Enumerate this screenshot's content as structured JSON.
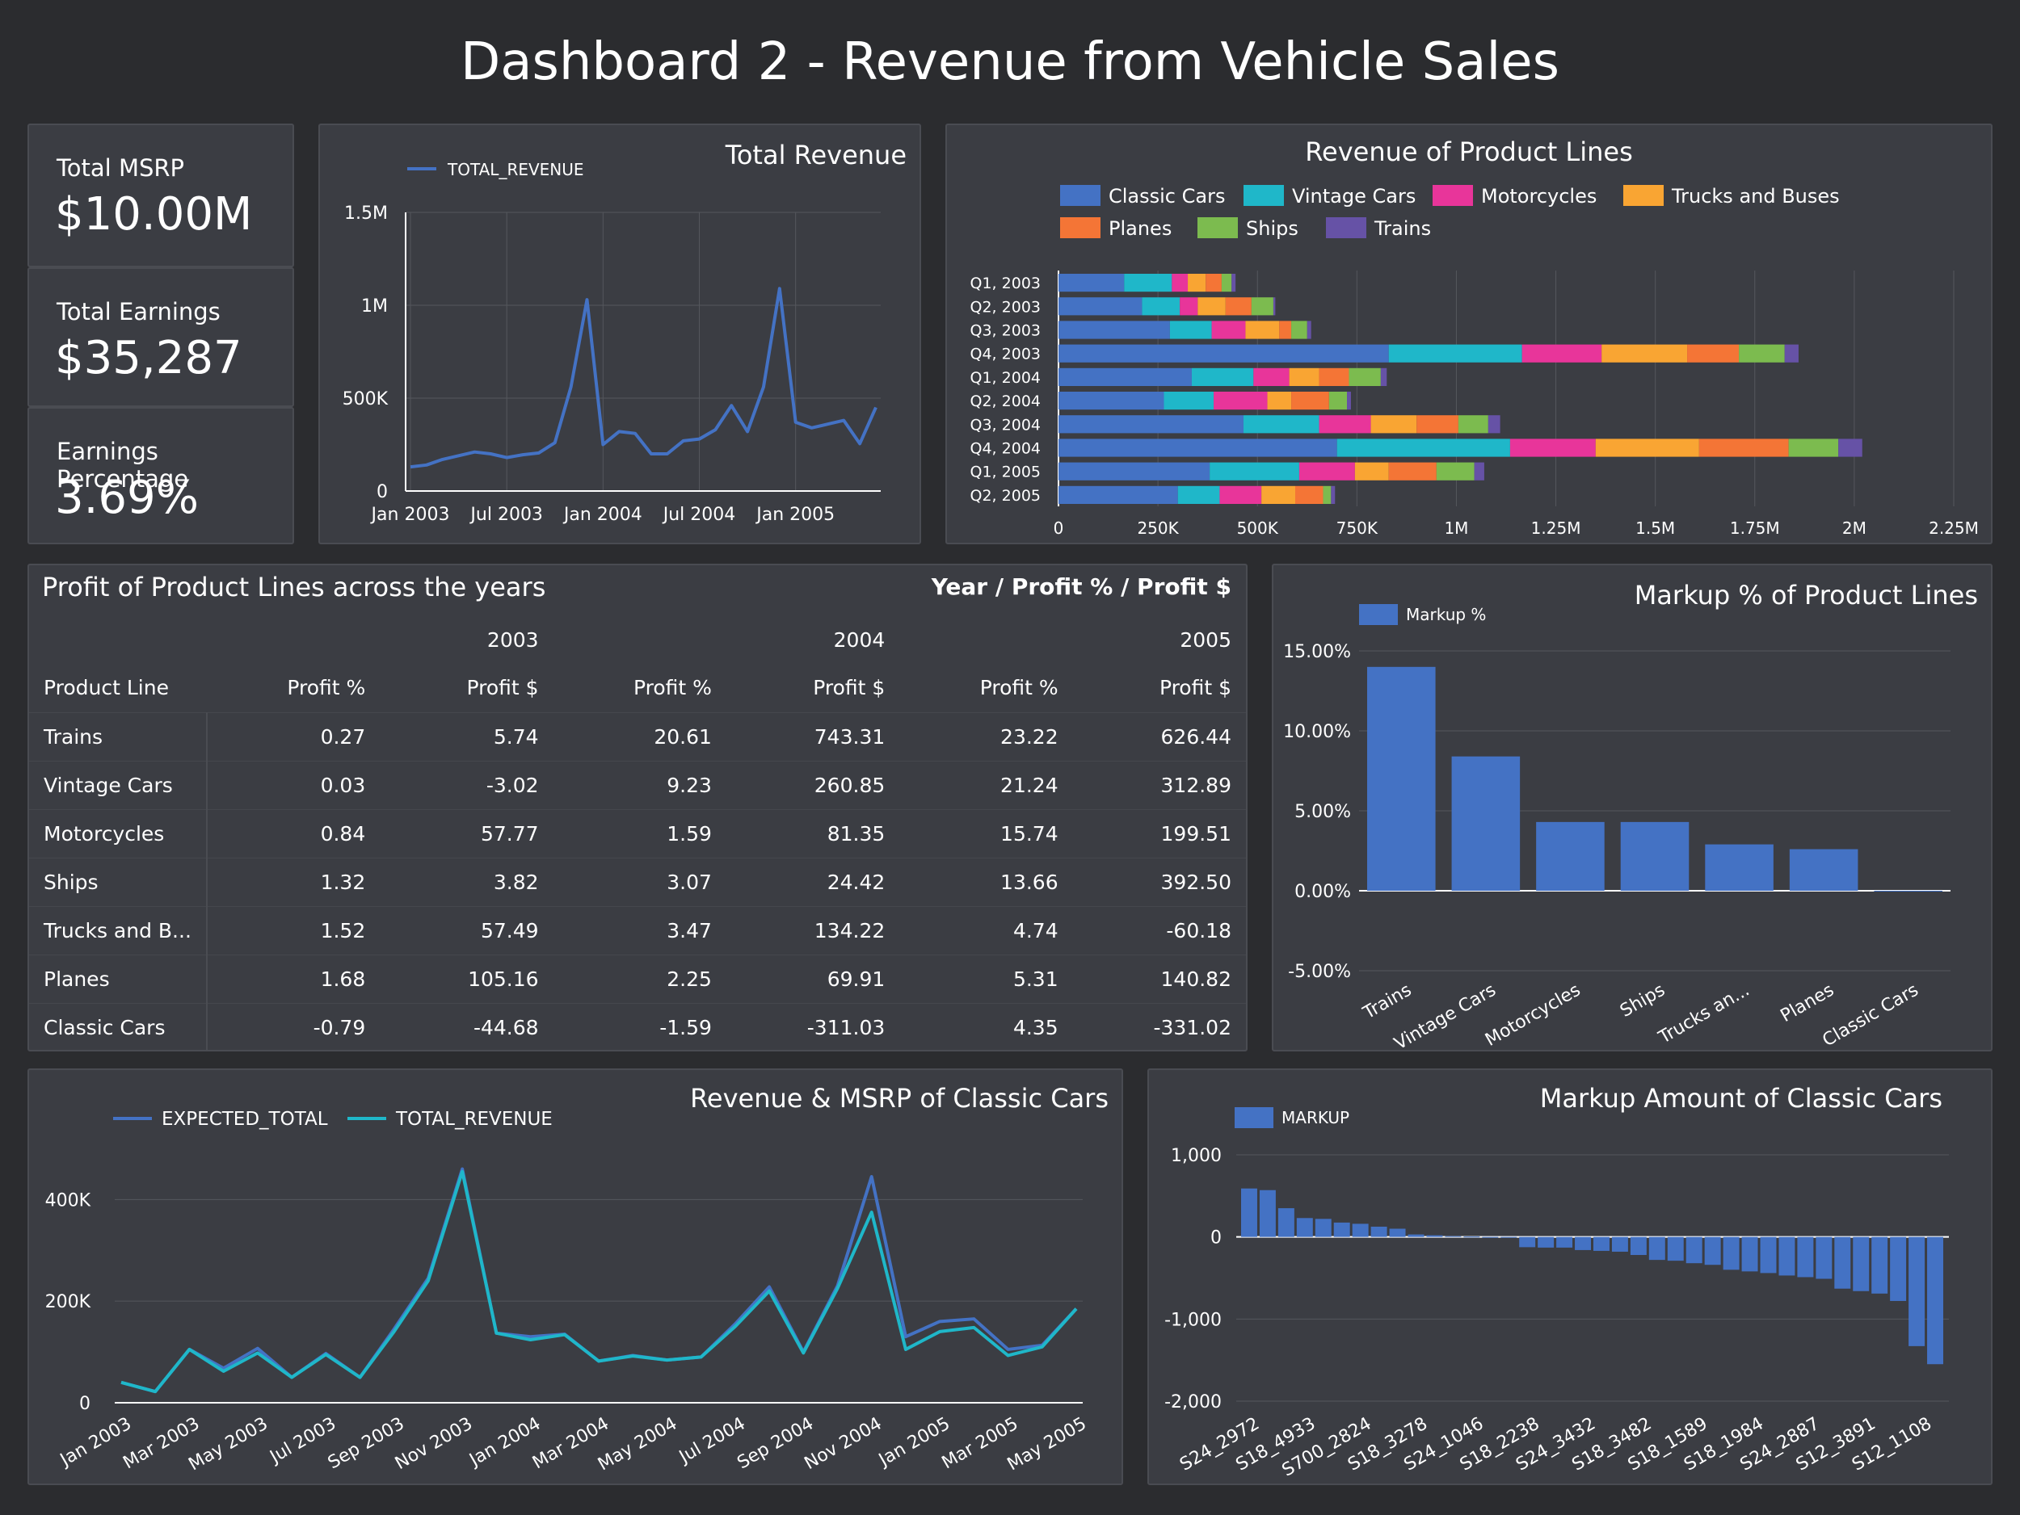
{
  "dashboard_title": "Dashboard 2 - Revenue from Vehicle Sales",
  "kpis": [
    {
      "label": "Total MSRP",
      "value": "$10.00M"
    },
    {
      "label": "Total Earnings",
      "value": "$35,287"
    },
    {
      "label": "Earnings Percentage",
      "value": "3.69%"
    }
  ],
  "colors": {
    "background": "#2b2c2f",
    "panel": "#3b3d43",
    "blue": "#4472c4",
    "cyan": "#1fb7c9",
    "product_lines": [
      "#4472c4",
      "#1fb7c9",
      "#e8359a",
      "#f9a533",
      "#f47536",
      "#7cbb4f",
      "#6652a6"
    ]
  },
  "pivot": {
    "title": "Profit of Product Lines across the years",
    "right_label": "Year / Profit % / Profit $",
    "years": [
      "2003",
      "2004",
      "2005"
    ],
    "row_header": "Product Line",
    "col_headers": [
      "Profit %",
      "Profit $",
      "Profit %",
      "Profit $",
      "Profit %",
      "Profit $"
    ],
    "rows": [
      {
        "name": "Trains",
        "cells": [
          "0.27",
          "5.74",
          "20.61",
          "743.31",
          "23.22",
          "626.44"
        ]
      },
      {
        "name": "Vintage Cars",
        "cells": [
          "0.03",
          "-3.02",
          "9.23",
          "260.85",
          "21.24",
          "312.89"
        ]
      },
      {
        "name": "Motorcycles",
        "cells": [
          "0.84",
          "57.77",
          "1.59",
          "81.35",
          "15.74",
          "199.51"
        ]
      },
      {
        "name": "Ships",
        "cells": [
          "1.32",
          "3.82",
          "3.07",
          "24.42",
          "13.66",
          "392.50"
        ]
      },
      {
        "name": "Trucks and B...",
        "cells": [
          "1.52",
          "57.49",
          "3.47",
          "134.22",
          "4.74",
          "-60.18"
        ]
      },
      {
        "name": "Planes",
        "cells": [
          "1.68",
          "105.16",
          "2.25",
          "69.91",
          "5.31",
          "140.82"
        ]
      },
      {
        "name": "Classic Cars",
        "cells": [
          "-0.79",
          "-44.68",
          "-1.59",
          "-311.03",
          "4.35",
          "-331.02"
        ]
      }
    ]
  },
  "chart_data": [
    {
      "id": "total_revenue",
      "type": "line",
      "title": "Total Revenue",
      "series": [
        {
          "name": "TOTAL_REVENUE",
          "values": [
            130000,
            140000,
            170000,
            190000,
            210000,
            200000,
            180000,
            195000,
            205000,
            260000,
            560000,
            1030000,
            250000,
            320000,
            310000,
            200000,
            200000,
            270000,
            280000,
            330000,
            460000,
            320000,
            560000,
            1090000,
            370000,
            340000,
            360000,
            380000,
            255000,
            450000
          ]
        }
      ],
      "x": [
        "Jan 2003",
        "Feb 2003",
        "Mar 2003",
        "Apr 2003",
        "May 2003",
        "Jun 2003",
        "Jul 2003",
        "Aug 2003",
        "Sep 2003",
        "Oct 2003",
        "Nov 2003",
        "Dec 2003",
        "Jan 2004",
        "Feb 2004",
        "Mar 2004",
        "Apr 2004",
        "May 2004",
        "Jun 2004",
        "Jul 2004",
        "Aug 2004",
        "Sep 2004",
        "Oct 2004",
        "Nov 2004",
        "Dec 2004",
        "Jan 2005",
        "Feb 2005",
        "Mar 2005",
        "Apr 2005",
        "May 2005",
        "Jun 2005"
      ],
      "x_ticks": [
        "Jan 2003",
        "Jul 2003",
        "Jan 2004",
        "Jul 2004",
        "Jan 2005"
      ],
      "y_ticks": [
        "0",
        "500K",
        "1M",
        "1.5M"
      ],
      "ylim": [
        0,
        1500000
      ]
    },
    {
      "id": "revenue_product_lines",
      "type": "bar",
      "orientation": "horizontal",
      "stacked": true,
      "title": "Revenue of Product Lines",
      "categories": [
        "Q1, 2003",
        "Q2, 2003",
        "Q3, 2003",
        "Q4, 2003",
        "Q1, 2004",
        "Q2, 2004",
        "Q3, 2004",
        "Q4, 2004",
        "Q1, 2005",
        "Q2, 2005"
      ],
      "series": [
        {
          "name": "Classic Cars",
          "values": [
            165000,
            210000,
            280000,
            830000,
            335000,
            265000,
            465000,
            700000,
            380000,
            300000
          ]
        },
        {
          "name": "Vintage Cars",
          "values": [
            120000,
            95000,
            105000,
            335000,
            155000,
            125000,
            190000,
            435000,
            225000,
            105000
          ]
        },
        {
          "name": "Motorcycles",
          "values": [
            40000,
            45000,
            85000,
            200000,
            90000,
            135000,
            130000,
            215000,
            140000,
            105000
          ]
        },
        {
          "name": "Trucks and Buses",
          "values": [
            45000,
            70000,
            85000,
            215000,
            75000,
            60000,
            115000,
            260000,
            85000,
            85000
          ]
        },
        {
          "name": "Planes",
          "values": [
            40000,
            65000,
            30000,
            130000,
            75000,
            95000,
            105000,
            225000,
            120000,
            70000
          ]
        },
        {
          "name": "Ships",
          "values": [
            25000,
            55000,
            40000,
            115000,
            80000,
            45000,
            75000,
            125000,
            95000,
            20000
          ]
        },
        {
          "name": "Trains",
          "values": [
            10000,
            5000,
            10000,
            35000,
            15000,
            10000,
            30000,
            60000,
            25000,
            10000
          ]
        }
      ],
      "x_ticks": [
        "0",
        "250K",
        "500K",
        "750K",
        "1M",
        "1.25M",
        "1.5M",
        "1.75M",
        "2M",
        "2.25M"
      ],
      "xlim": [
        0,
        2250000
      ]
    },
    {
      "id": "markup_product_lines",
      "type": "bar",
      "title": "Markup % of Product Lines",
      "categories": [
        "Trains",
        "Vintage Cars",
        "Motorcycles",
        "Ships",
        "Trucks an...",
        "Planes",
        "Classic Cars"
      ],
      "series": [
        {
          "name": "Markup %",
          "values": [
            14.0,
            8.4,
            4.3,
            4.3,
            2.9,
            2.6,
            -0.05
          ]
        }
      ],
      "y_ticks": [
        "-5.00%",
        "0.00%",
        "5.00%",
        "10.00%",
        "15.00%"
      ],
      "ylim": [
        -5,
        15
      ]
    },
    {
      "id": "revenue_msrp_classic",
      "type": "line",
      "title": "Revenue & MSRP of Classic Cars",
      "x": [
        "Jan 2003",
        "Feb 2003",
        "Mar 2003",
        "Apr 2003",
        "May 2003",
        "Jun 2003",
        "Jul 2003",
        "Aug 2003",
        "Sep 2003",
        "Oct 2003",
        "Nov 2003",
        "Dec 2003",
        "Jan 2004",
        "Feb 2004",
        "Mar 2004",
        "Apr 2004",
        "May 2004",
        "Jun 2004",
        "Jul 2004",
        "Aug 2004",
        "Sep 2004",
        "Oct 2004",
        "Nov 2004",
        "Dec 2004",
        "Jan 2005",
        "Feb 2005",
        "Mar 2005",
        "Apr 2005",
        "May 2005"
      ],
      "x_ticks": [
        "Jan 2003",
        "Mar 2003",
        "May 2003",
        "Jul 2003",
        "Sep 2003",
        "Nov 2003",
        "Jan 2004",
        "Mar 2004",
        "May 2004",
        "Jul 2004",
        "Sep 2004",
        "Nov 2004",
        "Jan 2005",
        "Mar 2005",
        "May 2005"
      ],
      "series": [
        {
          "name": "EXPECTED_TOTAL",
          "values": [
            40000,
            22000,
            105000,
            68000,
            107000,
            50000,
            97000,
            50000,
            145000,
            245000,
            460000,
            137000,
            130000,
            135000,
            82000,
            93000,
            84000,
            90000,
            155000,
            228000,
            100000,
            230000,
            445000,
            130000,
            160000,
            165000,
            105000,
            113000,
            185000
          ]
        },
        {
          "name": "TOTAL_REVENUE",
          "values": [
            40000,
            22000,
            105000,
            62000,
            98000,
            50000,
            95000,
            50000,
            140000,
            240000,
            455000,
            137000,
            124000,
            134000,
            82000,
            92000,
            84000,
            90000,
            150000,
            220000,
            98000,
            225000,
            375000,
            105000,
            140000,
            148000,
            93000,
            110000,
            185000
          ]
        }
      ],
      "y_ticks": [
        "0",
        "200K",
        "400K"
      ],
      "ylim": [
        0,
        480000
      ]
    },
    {
      "id": "markup_classic_cars",
      "type": "bar",
      "title": "Markup Amount of Classic Cars",
      "series": [
        {
          "name": "MARKUP",
          "values": [
            590,
            570,
            350,
            230,
            220,
            175,
            160,
            125,
            100,
            30,
            20,
            10,
            5,
            0,
            -5,
            -125,
            -130,
            -130,
            -160,
            -170,
            -180,
            -220,
            -280,
            -290,
            -320,
            -340,
            -400,
            -420,
            -440,
            -470,
            -490,
            -510,
            -630,
            -660,
            -690,
            -780,
            -1330,
            -1550
          ]
        }
      ],
      "x_tick_labels": [
        "S24_2972",
        "S18_4933",
        "S700_2824",
        "S18_3278",
        "S24_1046",
        "S18_2238",
        "S24_3432",
        "S18_3482",
        "S18_1589",
        "S18_1984",
        "S24_2887",
        "S12_3891",
        "S12_1108"
      ],
      "y_ticks": [
        "-2,000",
        "-1,000",
        "0",
        "1,000"
      ],
      "ylim": [
        -2000,
        1000
      ]
    }
  ]
}
